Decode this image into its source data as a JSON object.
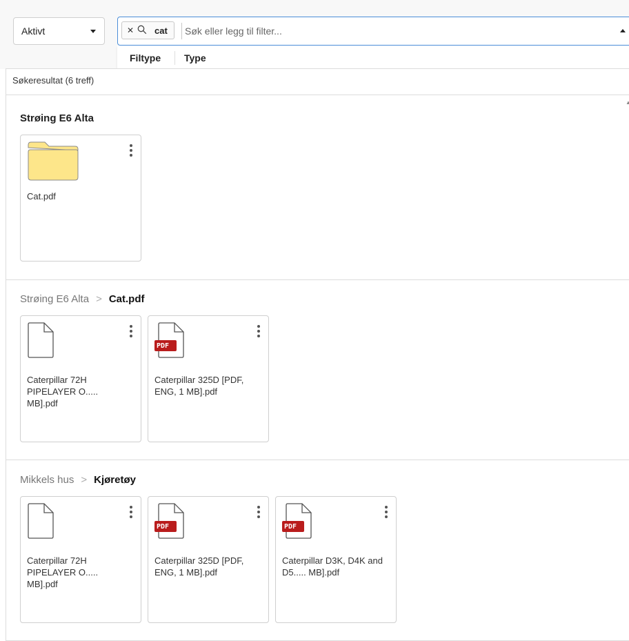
{
  "toolbar": {
    "status_filter": "Aktivt",
    "search": {
      "chip_text": "cat",
      "placeholder": "Søk eller legg til filter..."
    },
    "filter_options": [
      "Filtype",
      "Type"
    ]
  },
  "results": {
    "header": "Søkeresultat (6 treff)",
    "sections": [
      {
        "title": "Strøing E6 Alta",
        "items": [
          {
            "name": "Cat.pdf",
            "icon": "folder-icon"
          }
        ]
      },
      {
        "breadcrumb_parent": "Strøing E6 Alta",
        "breadcrumb_current": "Cat.pdf",
        "items": [
          {
            "name": "Caterpillar 72H PIPELAYER O..... MB].pdf",
            "icon": "document-icon"
          },
          {
            "name": "Caterpillar 325D [PDF, ENG, 1 MB].pdf",
            "icon": "pdf-file-icon",
            "badge": "PDF"
          }
        ]
      },
      {
        "breadcrumb_parent": "Mikkels hus",
        "breadcrumb_current": "Kjøretøy",
        "items": [
          {
            "name": "Caterpillar 72H PIPELAYER O..... MB].pdf",
            "icon": "document-icon"
          },
          {
            "name": "Caterpillar 325D [PDF, ENG, 1 MB].pdf",
            "icon": "pdf-file-icon",
            "badge": "PDF"
          },
          {
            "name": "Caterpillar D3K, D4K and D5..... MB].pdf",
            "icon": "pdf-file-icon",
            "badge": "PDF"
          }
        ]
      }
    ]
  },
  "colors": {
    "accent_border": "#4a8dd8",
    "folder_fill": "#fde68a",
    "pdf_badge": "#b91c1c"
  }
}
